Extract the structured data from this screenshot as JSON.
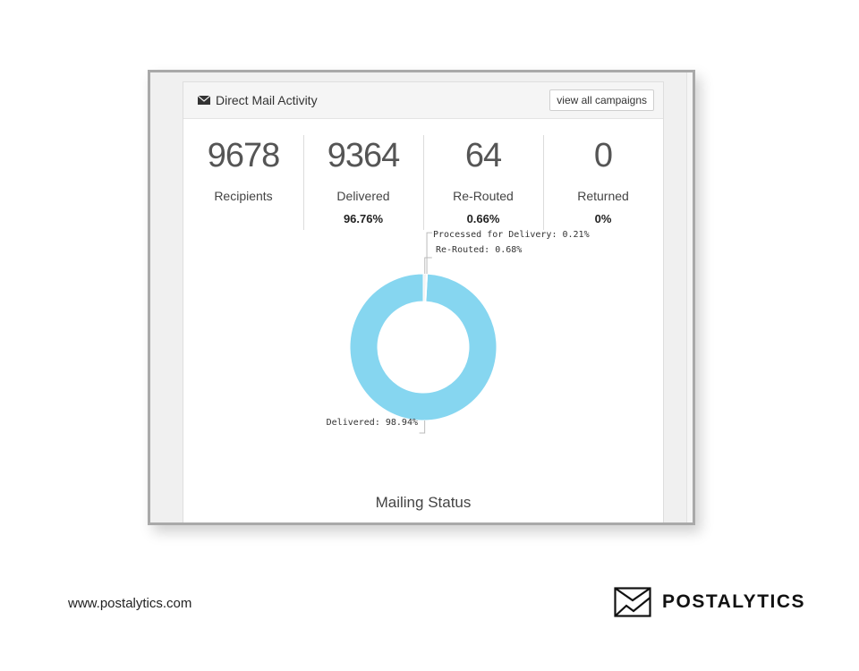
{
  "panel": {
    "title": "Direct Mail Activity",
    "view_button": "view all campaigns",
    "icon": "envelope-icon"
  },
  "stats": [
    {
      "value": "9678",
      "label": "Recipients",
      "pct": ""
    },
    {
      "value": "9364",
      "label": "Delivered",
      "pct": "96.76%"
    },
    {
      "value": "64",
      "label": "Re-Routed",
      "pct": "0.66%"
    },
    {
      "value": "0",
      "label": "Returned",
      "pct": "0%"
    }
  ],
  "chart_data": {
    "type": "pie",
    "title": "Mailing Status",
    "slices": [
      {
        "label": "Delivered: 98.94%",
        "value": 98.94,
        "color": "#86d6f0"
      },
      {
        "label": "Re-Routed: 0.68%",
        "value": 0.68,
        "color": "#f2f2f2"
      },
      {
        "label": "Processed for Delivery: 0.21%",
        "value": 0.21,
        "color": "#cfcfcf"
      }
    ]
  },
  "footer": {
    "url": "www.postalytics.com",
    "brand_name": "POSTALYTICS",
    "brand_icon": "envelope-chart-icon"
  }
}
